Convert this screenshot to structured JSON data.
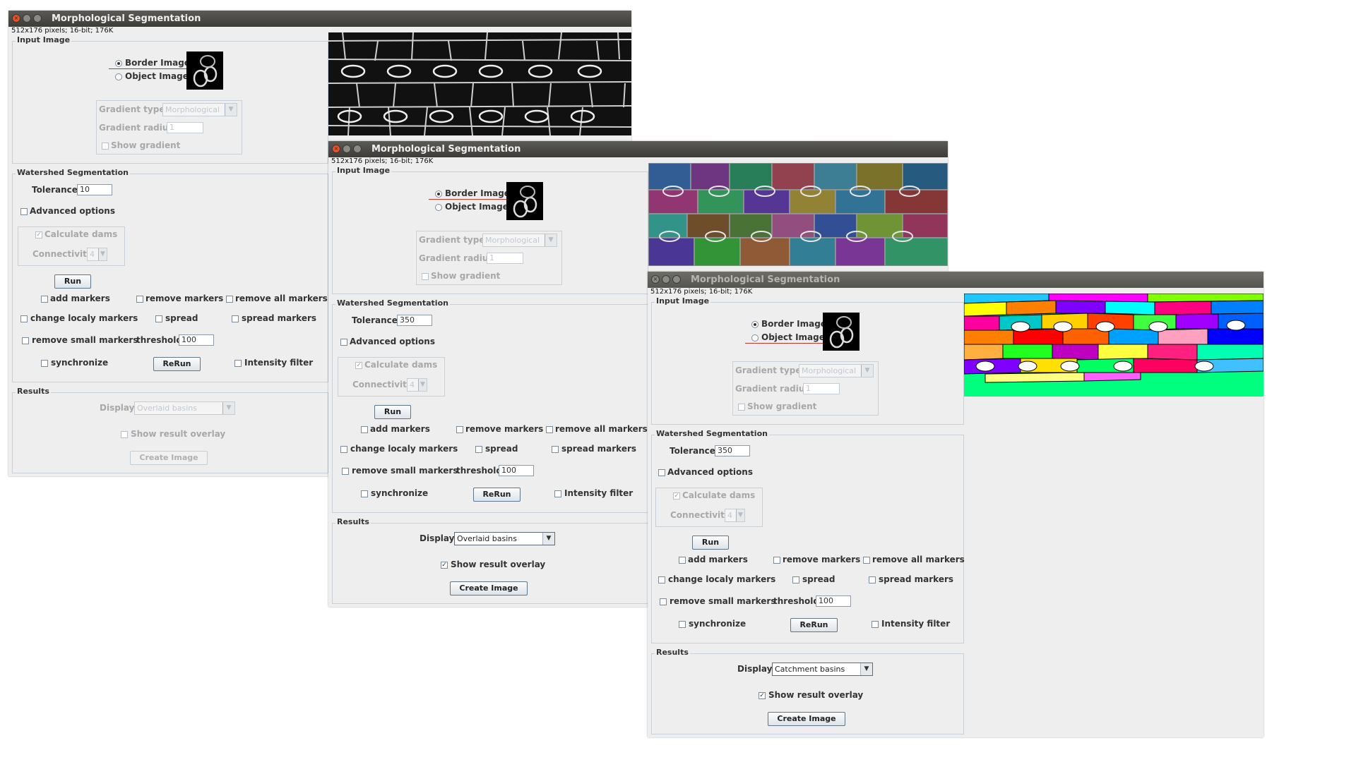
{
  "windows": [
    {
      "title": "Morphological Segmentation",
      "info": "512x176 pixels; 16-bit; 176K",
      "input_title": "Input Image",
      "border_label": "Border Image",
      "object_label": "Object Image",
      "selected_input": "border",
      "gradient_type_label": "Gradient type",
      "gradient_type_value": "Morphological",
      "gradient_radius_label": "Gradient radius",
      "gradient_radius_value": "1",
      "show_gradient_label": "Show gradient",
      "ws_title": "Watershed Segmentation",
      "tolerance_label": "Tolerance",
      "tolerance_value": "10",
      "advanced_label": "Advanced options",
      "calc_dams_label": "Calculate dams",
      "connectivity_label": "Connectivity",
      "connectivity_value": "4",
      "run_label": "Run",
      "add_markers": "add markers",
      "remove_markers": "remove markers",
      "remove_all_markers": "remove all markers",
      "change_markers": "change localy markers",
      "spread": "spread",
      "spread_markers": "spread markers",
      "remove_small": "remove small markers",
      "threshold_label": "threshold",
      "threshold_value": "100",
      "synchronize": "synchronize",
      "rerun_label": "ReRun",
      "intensity_filter": "Intensity filter",
      "results_title": "Results",
      "display_label": "Display",
      "display_value": "Overlaid basins",
      "show_overlay_label": "Show result overlay",
      "show_overlay_checked": false,
      "create_image_label": "Create Image",
      "results_enabled": false,
      "active": true
    },
    {
      "title": "Morphological Segmentation",
      "info": "512x176 pixels; 16-bit; 176K",
      "input_title": "Input Image",
      "border_label": "Border Image",
      "object_label": "Object Image",
      "selected_input": "border",
      "gradient_type_label": "Gradient type",
      "gradient_type_value": "Morphological",
      "gradient_radius_label": "Gradient radius",
      "gradient_radius_value": "1",
      "show_gradient_label": "Show gradient",
      "ws_title": "Watershed Segmentation",
      "tolerance_label": "Tolerance",
      "tolerance_value": "350",
      "advanced_label": "Advanced options",
      "calc_dams_label": "Calculate dams",
      "connectivity_label": "Connectivity",
      "connectivity_value": "4",
      "run_label": "Run",
      "add_markers": "add markers",
      "remove_markers": "remove markers",
      "remove_all_markers": "remove all markers",
      "change_markers": "change localy markers",
      "spread": "spread",
      "spread_markers": "spread markers",
      "remove_small": "remove small markers",
      "threshold_label": "threshold",
      "threshold_value": "100",
      "synchronize": "synchronize",
      "rerun_label": "ReRun",
      "intensity_filter": "Intensity filter",
      "results_title": "Results",
      "display_label": "Display",
      "display_value": "Overlaid basins",
      "show_overlay_label": "Show result overlay",
      "show_overlay_checked": true,
      "create_image_label": "Create Image",
      "results_enabled": true,
      "active": true
    },
    {
      "title": "Morphological Segmentation",
      "info": "512x176 pixels; 16-bit; 176K",
      "input_title": "Input Image",
      "border_label": "Border Image",
      "object_label": "Object Image",
      "selected_input": "border",
      "gradient_type_label": "Gradient type",
      "gradient_type_value": "Morphological",
      "gradient_radius_label": "Gradient radius",
      "gradient_radius_value": "1",
      "show_gradient_label": "Show gradient",
      "ws_title": "Watershed Segmentation",
      "tolerance_label": "Tolerance",
      "tolerance_value": "350",
      "advanced_label": "Advanced options",
      "calc_dams_label": "Calculate dams",
      "connectivity_label": "Connectivity",
      "connectivity_value": "4",
      "run_label": "Run",
      "add_markers": "add markers",
      "remove_markers": "remove markers",
      "remove_all_markers": "remove all markers",
      "change_markers": "change localy markers",
      "spread": "spread",
      "spread_markers": "spread markers",
      "remove_small": "remove small markers",
      "threshold_label": "threshold",
      "threshold_value": "100",
      "synchronize": "synchronize",
      "rerun_label": "ReRun",
      "intensity_filter": "Intensity filter",
      "results_title": "Results",
      "display_label": "Display",
      "display_value": "Catchment basins",
      "show_overlay_label": "Show result overlay",
      "show_overlay_checked": true,
      "create_image_label": "Create Image",
      "results_enabled": true,
      "active": false
    }
  ],
  "images": [
    {
      "style": "grayscale-borders",
      "icon": "cell-borders-image"
    },
    {
      "style": "overlaid-basins",
      "icon": "overlaid-basins-image"
    },
    {
      "style": "catchment-basins",
      "icon": "catchment-basins-image"
    }
  ]
}
